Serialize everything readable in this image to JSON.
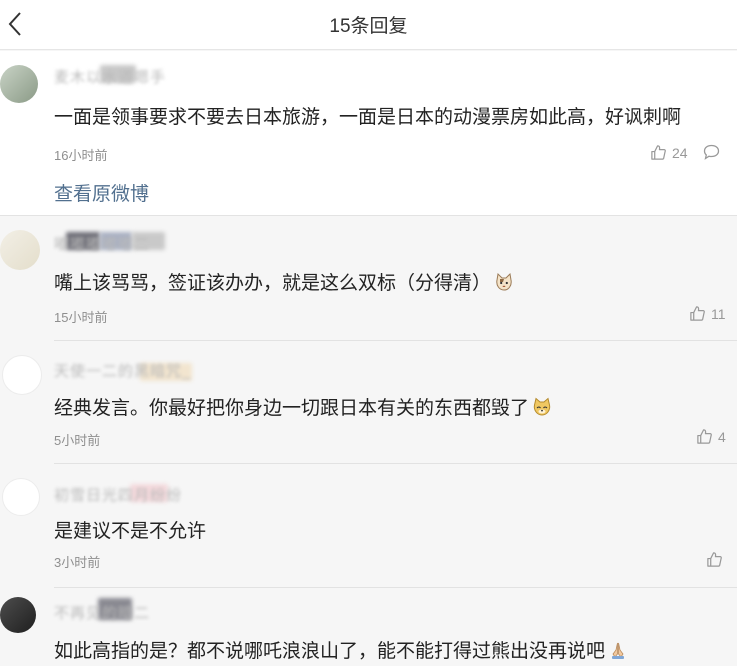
{
  "header": {
    "title": "15条回复"
  },
  "main_comment": {
    "username": "麦木以水道嗯手",
    "content": "一面是领事要求不要去日本旅游，一面是日本的动漫票房如此高，好讽刺啊",
    "time": "16小时前",
    "likes": "24",
    "view_original": "查看原微博"
  },
  "replies": [
    {
      "username": "嘟嘟嘟嘟嘟二",
      "content": "嘴上该骂骂，签证该办办，就是这么双标（分得清）",
      "emoji": "cat-face-icon",
      "time": "15小时前",
      "likes": "11"
    },
    {
      "username": "天使一二的黑暗咒_",
      "content": "经典发言。你最好把你身边一切跟日本有关的东西都毁了",
      "emoji": "doge-icon",
      "time": "5小时前",
      "likes": "4"
    },
    {
      "username": "初雪日光四月纷纷",
      "content": "是建议不是不允许",
      "time": "3小时前",
      "likes": ""
    },
    {
      "username": "不再见的暗二",
      "content": "如此高指的是？都不说哪吒浪浪山了，能不能打得过熊出没再说吧",
      "emoji": "folded-hands-icon"
    }
  ],
  "colors": {
    "link": "#52708f",
    "secondary_text": "#8f8f8f",
    "main_text": "#222222",
    "page_background": "#f6f6f6"
  }
}
